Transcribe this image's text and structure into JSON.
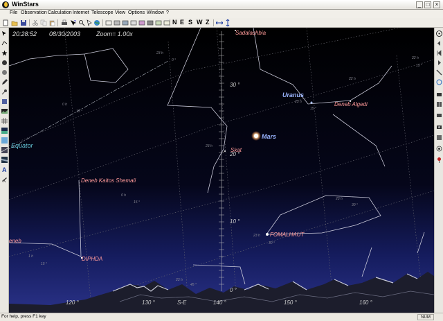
{
  "window": {
    "title": "WinStars",
    "minimize": "_",
    "maximize": "□",
    "close": "×"
  },
  "menu": [
    "File",
    "Observation",
    "Calculation",
    "Internet",
    "Telescope",
    "View",
    "Options",
    "Window",
    "?"
  ],
  "toolbar": {
    "directions": [
      "N",
      "E",
      "S",
      "W",
      "Z"
    ]
  },
  "sky": {
    "time": "20:28:52",
    "date": "08/30/2003",
    "zoom": "Zoom= 1.00x",
    "equator_label": "Equator",
    "stars": {
      "sadalachbia": "Sadalachbia",
      "deneb_algedi": "Deneb Algedi",
      "skat": "Skat",
      "deneb_kaitos_shemali": "Deneb Kaitos Shemali",
      "fomalhaut": "FOMALHAUT",
      "diphda": "DIPHDA",
      "deneb_edge": "eneb"
    },
    "planets": {
      "uranus": "Uranus",
      "mars": "Mars"
    },
    "altitude_labels": [
      "30 °",
      "20 °",
      "10 °",
      "0 °"
    ],
    "azimuth_labels": [
      "120 °",
      "130 °",
      "S-E",
      "140 °",
      "150 °",
      "160 °"
    ],
    "grid_labels": {
      "ra_23h_top": "23 h",
      "dec_0_top": "0 °",
      "ra_0h_left": "0 h",
      "dec_15_upper": "15 °",
      "ra_23h_mid": "23 h",
      "dec_15_lower": "15 °",
      "ra_0h_mid": "0 h",
      "ra_23h_lower": "23 h",
      "dec_30_lower": "30 °",
      "ra_23h_fomalhaut": "23 h",
      "dec_30_fomalhaut": "30 °",
      "ra_1h_bottom": "1 h",
      "dec_15_bottom": "15 °",
      "ra_22h_right": "22 h",
      "dec_15_right": "15 °",
      "ra_22h_farright": "22 h",
      "ra_23h_uranus": "23 h",
      "ra_23h_bottom": "23 h",
      "dec_45_bottom": "45 °"
    }
  },
  "status": {
    "help": "For help, press F1 key",
    "num": "NUM"
  },
  "colors": {
    "sky_top": "#000000",
    "sky_horizon": "#2a3288",
    "star_label": "#ff9a9a",
    "planet_label": "#9ab4ff",
    "equator": "#66c6d8",
    "constellation": "#c8c8d8",
    "grid": "#6a6a74"
  }
}
